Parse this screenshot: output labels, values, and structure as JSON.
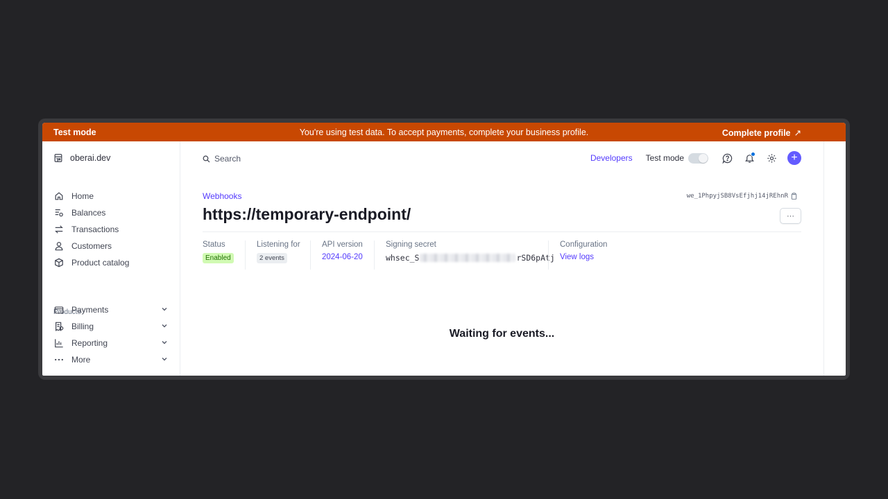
{
  "banner": {
    "mode_label": "Test mode",
    "message": "You're using test data. To accept payments, complete your business profile.",
    "cta_label": "Complete profile",
    "cta_arrow": "↗",
    "color": "#c84802"
  },
  "sidebar": {
    "account_name": "oberai.dev",
    "nav": [
      {
        "label": "Home",
        "icon": "home-icon"
      },
      {
        "label": "Balances",
        "icon": "balances-icon"
      },
      {
        "label": "Transactions",
        "icon": "transactions-icon"
      },
      {
        "label": "Customers",
        "icon": "customers-icon"
      },
      {
        "label": "Product catalog",
        "icon": "product-catalog-icon"
      }
    ],
    "section_label": "Products",
    "products": [
      {
        "label": "Payments",
        "icon": "payments-icon"
      },
      {
        "label": "Billing",
        "icon": "billing-icon"
      },
      {
        "label": "Reporting",
        "icon": "reporting-icon"
      },
      {
        "label": "More",
        "icon": "more-icon"
      }
    ]
  },
  "topbar": {
    "search_label": "Search",
    "developers_label": "Developers",
    "test_mode_label": "Test mode",
    "test_mode_on": false,
    "accent": "#635bff"
  },
  "page": {
    "breadcrumb": "Webhooks",
    "title": "https://temporary-endpoint/",
    "endpoint_id": "we_1PhpyjSB8VsEfjhj14jREhnR",
    "more_label": "···",
    "meta": {
      "status_label": "Status",
      "status_value": "Enabled",
      "listening_label": "Listening for",
      "listening_value": "2 events",
      "api_version_label": "API version",
      "api_version_value": "2024-06-20",
      "secret_label": "Signing secret",
      "secret_prefix": "whsec_S",
      "secret_suffix": "rSD6pAtj",
      "config_label": "Configuration",
      "config_value": "View logs"
    },
    "empty_state": "Waiting for events..."
  }
}
